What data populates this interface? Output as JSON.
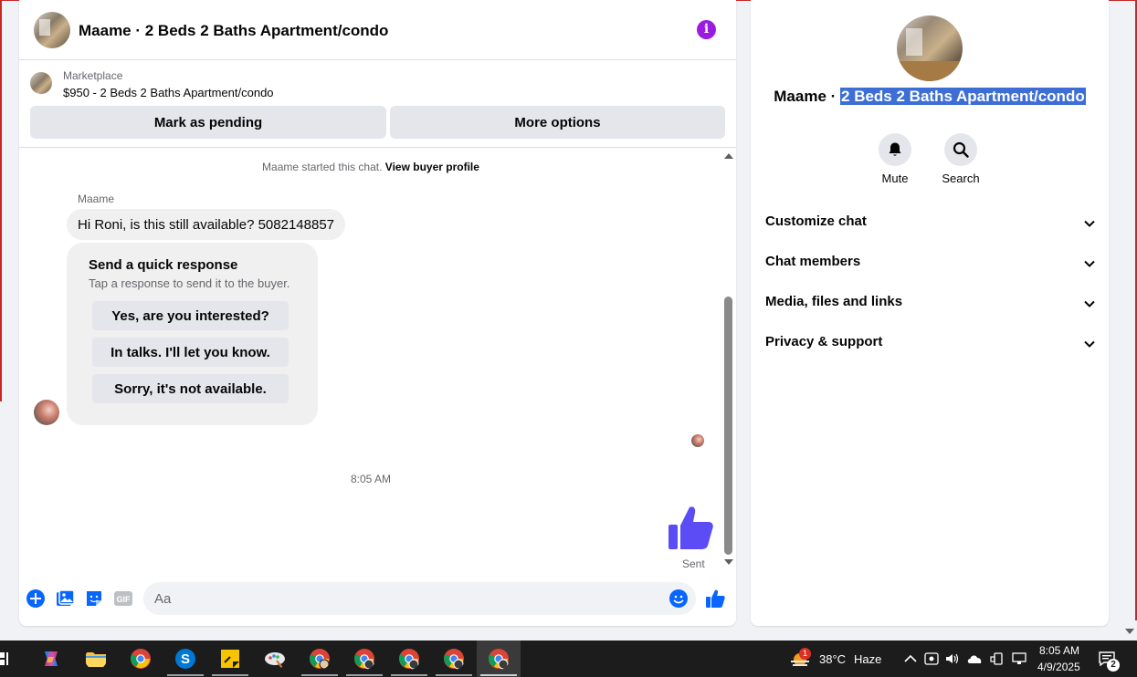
{
  "chat": {
    "title": "Maame · 2 Beds 2 Baths Apartment/condo",
    "marketplace_label": "Marketplace",
    "listing": "$950 - 2 Beds 2 Baths Apartment/condo",
    "mark_pending": "Mark as pending",
    "more_options": "More options",
    "started_prefix": "Maame started this chat.",
    "view_buyer_profile": "View buyer profile",
    "sender_name": "Maame",
    "message": "Hi Roni, is this still available? 5082148857",
    "quick_response": {
      "title": "Send a quick response",
      "subtitle": "Tap a response to send it to the buyer.",
      "options": [
        "Yes, are you interested?",
        "In talks. I'll let you know.",
        "Sorry, it's not available."
      ]
    },
    "timestamp": "8:05 AM",
    "sent_label": "Sent",
    "composer_placeholder": "Aa",
    "composer_gif": "GIF"
  },
  "details": {
    "name_prefix": "Maame · ",
    "name_highlight": "2 Beds 2 Baths Apartment/condo",
    "mute_label": "Mute",
    "search_label": "Search",
    "sections": [
      "Customize chat",
      "Chat members",
      "Media, files and links",
      "Privacy & support"
    ]
  },
  "taskbar": {
    "weather_badge": "1",
    "temperature": "38°C",
    "weather": "Haze",
    "time": "8:05 AM",
    "date": "4/9/2025",
    "notifications": "2"
  },
  "colors": {
    "accent": "#0866ff",
    "like": "#5b4cf5",
    "info": "#9b1ce0",
    "highlight": "#3d6ed6"
  }
}
